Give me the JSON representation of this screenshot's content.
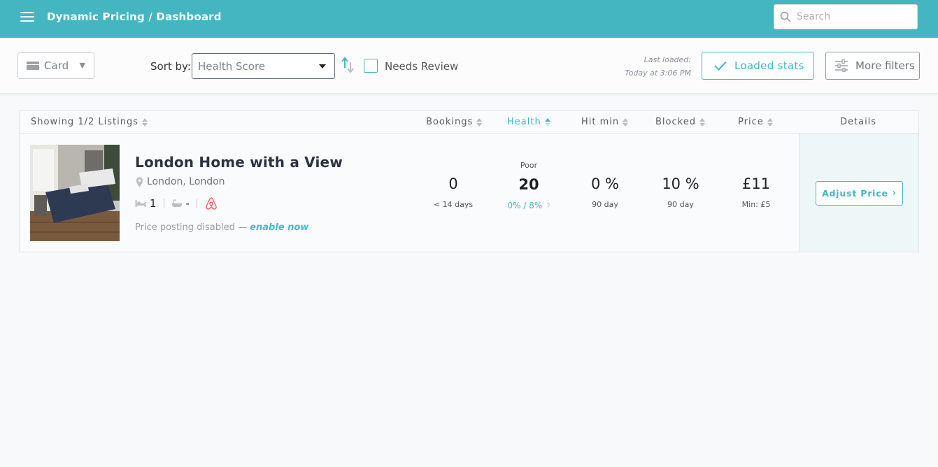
{
  "header": {
    "title": "Dynamic Pricing / Dashboard",
    "search_placeholder": "Search"
  },
  "toolbar": {
    "view_mode": "Card",
    "sort_label": "Sort by:",
    "sort_value": "Health Score",
    "needs_review_label": "Needs Review",
    "needs_review_checked": false,
    "last_loaded_label": "Last loaded:",
    "last_loaded_time": "Today at 3:06 PM",
    "loaded_stats_label": "Loaded stats",
    "more_filters_label": "More filters"
  },
  "table": {
    "columns": {
      "listings": "Showing 1/2 Listings",
      "bookings": "Bookings",
      "health": "Health",
      "hit_min": "Hit min",
      "blocked": "Blocked",
      "price": "Price",
      "details": "Details"
    },
    "active_sort_column": "health",
    "rows": [
      {
        "title": "London Home with a View",
        "location": "London, London",
        "beds": "1",
        "baths": "-",
        "platform": "airbnb-icon",
        "price_posting_text": "Price posting disabled — ",
        "enable_link": "enable now",
        "bookings_value": "0",
        "bookings_sub": "< 14 days",
        "health_label": "Poor",
        "health_value": "20",
        "health_sub": "0% / 8%",
        "health_help": "?",
        "hit_min_value": "0 %",
        "hit_min_sub": "90 day",
        "blocked_value": "10 %",
        "blocked_sub": "90 day",
        "price_value": "£11",
        "price_sub": "Min: £5",
        "action_label": "Adjust Price"
      }
    ]
  },
  "colors": {
    "brand": "#43b6c2",
    "link": "#3bbfd2",
    "airbnb": "#ff5a5f"
  }
}
